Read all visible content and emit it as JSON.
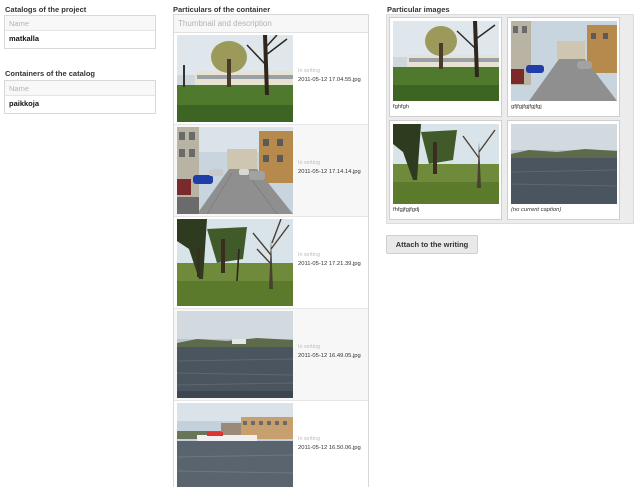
{
  "catalogs": {
    "title": "Catalogs of the project",
    "header": "Name",
    "rows": [
      "matkalla"
    ]
  },
  "containers": {
    "title": "Containers of the catalog",
    "header": "Name",
    "rows": [
      "paikkoja"
    ]
  },
  "particulars": {
    "title": "Particulars of the container",
    "header": "Thumbnail and description",
    "items": [
      {
        "status": "In writing",
        "file": "2011-05-12 17.04.55.jpg"
      },
      {
        "status": "In writing",
        "file": "2011-05-12 17.14.14.jpg"
      },
      {
        "status": "In writing",
        "file": "2011-05-12 17.21.39.jpg"
      },
      {
        "status": "In writing",
        "file": "2011-05-12 16.49.05.jpg"
      },
      {
        "status": "In writing",
        "file": "2011-05-12 16.50.06.jpg"
      }
    ]
  },
  "particular_images": {
    "title": "Particular images",
    "tiles": [
      {
        "caption": "fghfgh"
      },
      {
        "caption": "gfjfgjfgjfgjfgj"
      },
      {
        "caption": "fhfgjfgjfgdj"
      },
      {
        "caption": "(no current caption)"
      }
    ]
  },
  "actions": {
    "attach_label": "Attach to the writing"
  }
}
